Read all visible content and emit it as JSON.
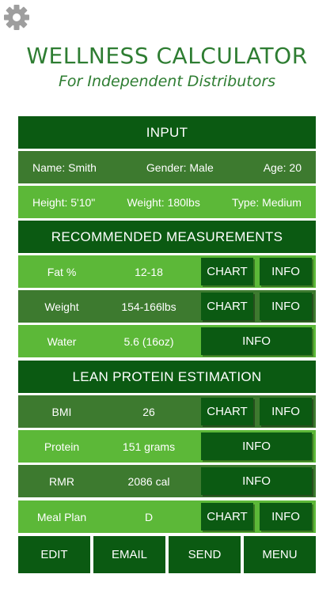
{
  "app": {
    "title": "WELLNESS CALCULATOR",
    "subtitle": "For Independent Distributors"
  },
  "input": {
    "header": "INPUT",
    "name": "Name: Smith",
    "gender": "Gender: Male",
    "age": "Age: 20",
    "height": "Height: 5'10\"",
    "weight": "Weight: 180lbs",
    "type": "Type: Medium"
  },
  "recommended": {
    "header": "RECOMMENDED MEASUREMENTS",
    "rows": [
      {
        "label": "Fat %",
        "value": "12-18",
        "chart": "CHART",
        "info": "INFO"
      },
      {
        "label": "Weight",
        "value": "154-166lbs",
        "chart": "CHART",
        "info": "INFO"
      },
      {
        "label": "Water",
        "value": "5.6 (16oz)",
        "info": "INFO"
      }
    ]
  },
  "protein": {
    "header": "LEAN PROTEIN ESTIMATION",
    "rows": [
      {
        "label": "BMI",
        "value": "26",
        "chart": "CHART",
        "info": "INFO"
      },
      {
        "label": "Protein",
        "value": "151 grams",
        "info": "INFO"
      },
      {
        "label": "RMR",
        "value": "2086 cal",
        "info": "INFO"
      },
      {
        "label": "Meal Plan",
        "value": "D",
        "chart": "CHART",
        "info": "INFO"
      }
    ]
  },
  "bottom_bar": {
    "edit": "EDIT",
    "email": "EMAIL",
    "send": "SEND",
    "menu": "MENU"
  },
  "colors": {
    "title_green": "#2e7d32",
    "dark_green": "#0b5a12",
    "mid_green": "#3d7a2f",
    "light_green": "#5cb838"
  },
  "icons": {
    "settings": "gear-icon"
  }
}
